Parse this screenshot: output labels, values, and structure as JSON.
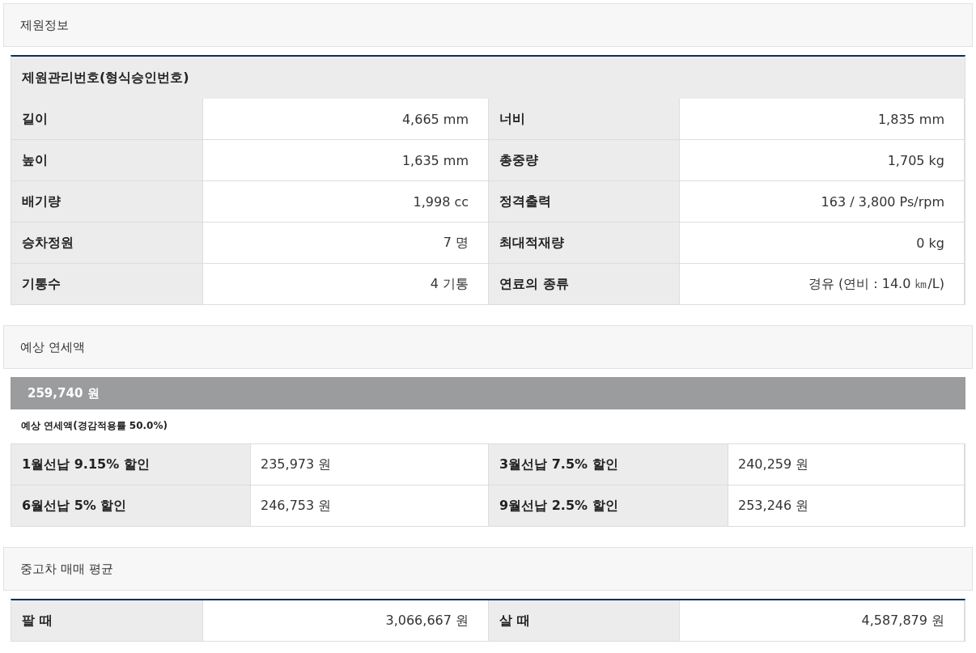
{
  "specs": {
    "title": "제원정보",
    "caption": "제원관리번호(형식승인번호)",
    "rows": [
      [
        {
          "label": "길이",
          "value": "4,665 mm"
        },
        {
          "label": "너비",
          "value": "1,835 mm"
        }
      ],
      [
        {
          "label": "높이",
          "value": "1,635 mm"
        },
        {
          "label": "총중량",
          "value": "1,705 kg"
        }
      ],
      [
        {
          "label": "배기량",
          "value": "1,998 cc"
        },
        {
          "label": "정격출력",
          "value": "163 / 3,800 Ps/rpm"
        }
      ],
      [
        {
          "label": "승차정원",
          "value": "7 명"
        },
        {
          "label": "최대적재량",
          "value": "0 kg"
        }
      ],
      [
        {
          "label": "기통수",
          "value": "4 기통"
        },
        {
          "label": "연료의 종류",
          "value": "경유 (연비 : 14.0 ㎞/L)"
        }
      ]
    ]
  },
  "tax": {
    "title": "예상 연세액",
    "amount": "259,740 원",
    "note": "예상 연세액(경감적용률 50.0%)",
    "rows": [
      [
        {
          "label": "1월선납 9.15% 할인",
          "value": "235,973 원"
        },
        {
          "label": "3월선납 7.5% 할인",
          "value": "240,259 원"
        }
      ],
      [
        {
          "label": "6월선납 5% 할인",
          "value": "246,753 원"
        },
        {
          "label": "9월선납 2.5% 할인",
          "value": "253,246 원"
        }
      ]
    ]
  },
  "used_car": {
    "title": "중고차 매매 평균",
    "rows": [
      [
        {
          "label": "팔 때",
          "value": "3,066,667 원"
        },
        {
          "label": "살 때",
          "value": "4,587,879 원"
        }
      ]
    ]
  }
}
